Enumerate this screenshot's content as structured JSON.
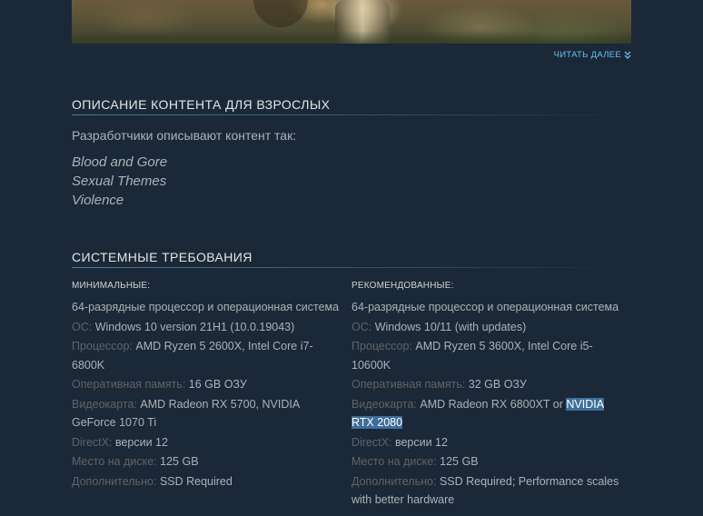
{
  "read_more": {
    "label": "ЧИТАТЬ ДАЛЕЕ",
    "icon": "double-chevron-down-icon"
  },
  "mature": {
    "title": "ОПИСАНИЕ КОНТЕНТА ДЛЯ ВЗРОСЛЫХ",
    "intro": "Разработчики описывают контент так:",
    "items": [
      "Blood and Gore",
      "Sexual Themes",
      "Violence"
    ]
  },
  "sysreq": {
    "title": "СИСТЕМНЫЕ ТРЕБОВАНИЯ",
    "minimum": {
      "title": "МИНИМАЛЬНЫЕ:",
      "note": "64-разрядные процессор и операционная система",
      "os_label": "ОС:",
      "os": "Windows 10 version 21H1 (10.0.19043)",
      "cpu_label": "Процессор:",
      "cpu": "AMD Ryzen 5 2600X, Intel Core i7-6800K",
      "ram_label": "Оперативная память:",
      "ram": "16 GB ОЗУ",
      "gpu_label": "Видеокарта:",
      "gpu": "AMD Radeon RX 5700, NVIDIA GeForce 1070 Ti",
      "dx_label": "DirectX:",
      "dx": "версии 12",
      "disk_label": "Место на диске:",
      "disk": "125 GB",
      "extra_label": "Дополнительно:",
      "extra": "SSD Required"
    },
    "recommended": {
      "title": "РЕКОМЕНДОВАННЫЕ:",
      "note": "64-разрядные процессор и операционная система",
      "os_label": "ОС:",
      "os": "Windows 10/11 (with updates)",
      "cpu_label": "Процессор:",
      "cpu": "AMD Ryzen 5 3600X, Intel Core i5-10600K",
      "ram_label": "Оперативная память:",
      "ram": "32 GB ОЗУ",
      "gpu_label": "Видеокарта:",
      "gpu": "AMD Radeon RX 6800XT or ",
      "gpu_highlight": "NVIDIA RTX 2080",
      "dx_label": "DirectX:",
      "dx": "версии 12",
      "disk_label": "Место на диске:",
      "disk": "125 GB",
      "extra_label": "Дополнительно:",
      "extra": "SSD Required; Performance scales with better hardware"
    }
  },
  "colors": {
    "background": "#1b2838",
    "link": "#66c0f4",
    "heading": "#e5e5e5",
    "text": "#acb2b8",
    "label": "#626366",
    "selection": "#3d6f9a"
  }
}
